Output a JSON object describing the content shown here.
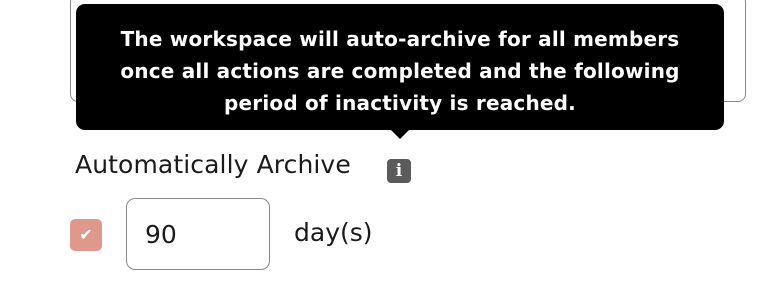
{
  "tooltip": {
    "text": "The workspace will auto-archive for all members once all actions are completed and the following period of inactivity is reached."
  },
  "archive": {
    "title": "Automatically Archive",
    "info_icon": "info-icon",
    "enabled": true,
    "checkbox_icon": "checkmark-icon",
    "days_value": "90",
    "unit_label": "day(s)"
  },
  "colors": {
    "tooltip_bg": "#000000",
    "checkbox_bg": "#de998c",
    "info_icon_bg": "#5b5b5b"
  }
}
